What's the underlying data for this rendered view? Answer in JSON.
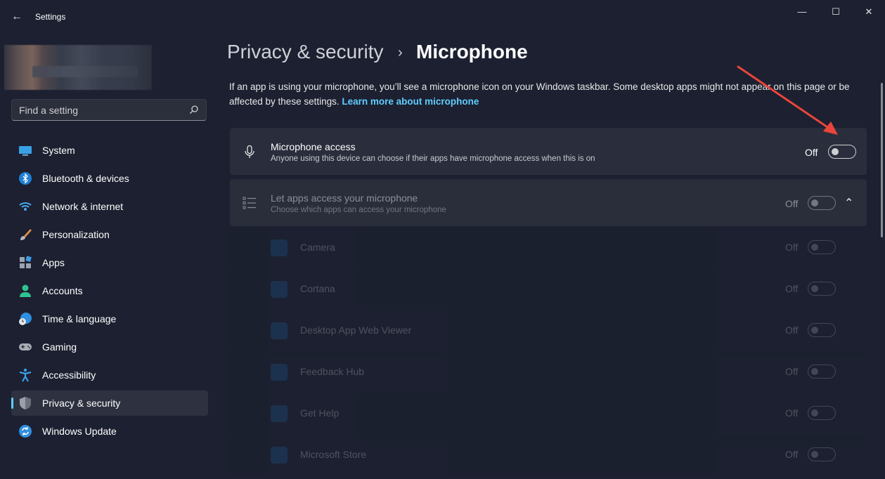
{
  "window": {
    "title": "Settings",
    "back_glyph": "←",
    "minimize_glyph": "—",
    "maximize_glyph": "☐",
    "close_glyph": "✕"
  },
  "search": {
    "placeholder": "Find a setting"
  },
  "sidebar": {
    "items": [
      {
        "label": "System",
        "icon": "system-icon"
      },
      {
        "label": "Bluetooth & devices",
        "icon": "bluetooth-icon"
      },
      {
        "label": "Network & internet",
        "icon": "network-icon"
      },
      {
        "label": "Personalization",
        "icon": "brush-icon"
      },
      {
        "label": "Apps",
        "icon": "apps-icon"
      },
      {
        "label": "Accounts",
        "icon": "account-icon"
      },
      {
        "label": "Time & language",
        "icon": "globe-clock-icon"
      },
      {
        "label": "Gaming",
        "icon": "gamepad-icon"
      },
      {
        "label": "Accessibility",
        "icon": "accessibility-icon"
      },
      {
        "label": "Privacy & security",
        "icon": "shield-icon",
        "active": true
      },
      {
        "label": "Windows Update",
        "icon": "update-icon"
      }
    ]
  },
  "breadcrumb": {
    "parent": "Privacy & security",
    "separator": "›",
    "current": "Microphone"
  },
  "description": {
    "text": "If an app is using your microphone, you’ll see a microphone icon on your Windows taskbar. Some desktop apps might not appear on this page or be affected by these settings.",
    "link": "Learn more about microphone"
  },
  "mic_access": {
    "title": "Microphone access",
    "subtitle": "Anyone using this device can choose if their apps have microphone access when this is on",
    "state": "Off"
  },
  "let_apps": {
    "title": "Let apps access your microphone",
    "subtitle": "Choose which apps can access your microphone",
    "state": "Off",
    "chevron": "⌃"
  },
  "apps": [
    {
      "label": "Camera",
      "state": "Off"
    },
    {
      "label": "Cortana",
      "state": "Off"
    },
    {
      "label": "Desktop App Web Viewer",
      "state": "Off"
    },
    {
      "label": "Feedback Hub",
      "state": "Off"
    },
    {
      "label": "Get Help",
      "state": "Off"
    },
    {
      "label": "Microsoft Store",
      "state": "Off"
    }
  ],
  "colors": {
    "accent": "#60cdff",
    "background": "#1c2030",
    "card": "#2a2e3c",
    "annotation_arrow": "#e8453c"
  }
}
